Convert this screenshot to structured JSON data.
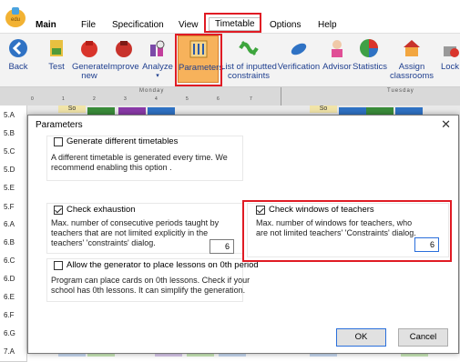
{
  "menubar": {
    "items": [
      {
        "label": "Main"
      },
      {
        "label": "File"
      },
      {
        "label": "Specification"
      },
      {
        "label": "View"
      },
      {
        "label": "Timetable"
      },
      {
        "label": "Options"
      },
      {
        "label": "Help"
      }
    ]
  },
  "ribbon": {
    "buttons": [
      {
        "label": "Back"
      },
      {
        "label": "Test"
      },
      {
        "label": "Generate new"
      },
      {
        "label": "Improve"
      },
      {
        "label": "Analyze"
      },
      {
        "label": "Parameters"
      },
      {
        "label": "List of inputted constraints"
      },
      {
        "label": "Verification"
      },
      {
        "label": "Advisor"
      },
      {
        "label": "Statistics"
      },
      {
        "label": "Assign classrooms"
      },
      {
        "label": "Lock"
      }
    ]
  },
  "grid": {
    "days": [
      "Monday",
      "Tuesday"
    ],
    "periods": [
      "0",
      "1",
      "2",
      "3",
      "4",
      "5",
      "6",
      "7"
    ],
    "classes": [
      "5.A",
      "5.B",
      "5.C",
      "5.D",
      "5.E",
      "5.F",
      "6.A",
      "6.B",
      "6.C",
      "6.D",
      "6.E",
      "6.F",
      "6.G",
      "7.A"
    ],
    "visible_cells": [
      "So",
      "So",
      "Ma",
      "Ch",
      "Hi",
      "Ch",
      "Ma",
      "Ma",
      "Ch"
    ]
  },
  "dialog": {
    "title": "Parameters",
    "close_glyph": "✕",
    "different_timetables": {
      "label": "Generate different timetables",
      "checked": false,
      "description_line1": "A different timetable is generated every time. We",
      "description_line2": "recommend enabling this option ."
    },
    "exhaustion": {
      "label": "Check exhaustion",
      "checked": true,
      "description_line1": "Max. number of consecutive periods taught by",
      "description_line2": "teachers that are not limited explicitly in the",
      "description_line3": "teachers' 'constraints' dialog.",
      "value": "6"
    },
    "windows": {
      "label": "Check windows of teachers",
      "checked": true,
      "description_line1": "Max. number of windows for teachers, who",
      "description_line2": "are not limited teachers' 'Constraints' dialog.",
      "value": "6"
    },
    "zeroth_period": {
      "label": "Allow the generator to place lessons on 0th period",
      "checked": false,
      "description_line1": "Program can place cards on 0th lessons. Check if your",
      "description_line2": "school has 0th lessons. It can simplify the generation."
    },
    "ok_label": "OK",
    "cancel_label": "Cancel"
  },
  "colors": {
    "highlight": "#e01b24",
    "accent_blue": "#2a6fdb",
    "selected_button": "#f7b25b"
  }
}
